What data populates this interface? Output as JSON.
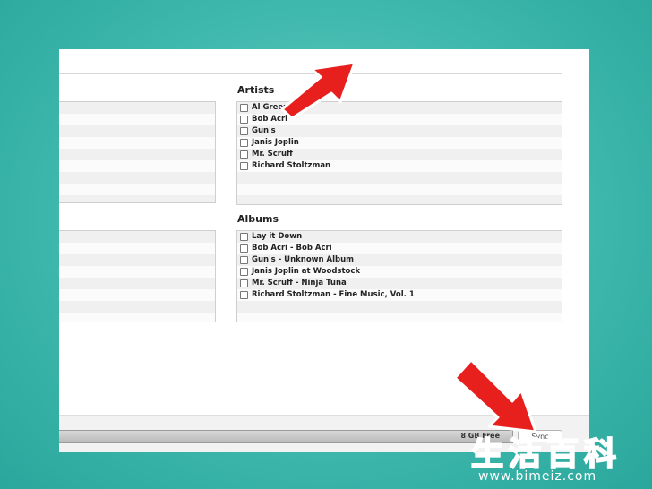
{
  "artists": {
    "title": "Artists",
    "items": [
      "Al Green",
      "Bob Acri",
      "Gun's",
      "Janis Joplin",
      "Mr. Scruff",
      "Richard Stoltzman"
    ]
  },
  "albums": {
    "title": "Albums",
    "items": [
      "Lay it Down",
      "Bob Acri - Bob Acri",
      "Gun's - Unknown Album",
      "Janis Joplin at Woodstock",
      "Mr. Scruff - Ninja Tuna",
      "Richard Stoltzman - Fine Music, Vol. 1"
    ]
  },
  "footer": {
    "capacity_label": "8 GB Free",
    "sync_label": "Sync"
  },
  "watermark": {
    "chars": [
      "生",
      "活",
      "百",
      "科"
    ],
    "url": "www.bimeiz.com"
  },
  "colors": {
    "background": "#3fb8ad",
    "arrow": "#e8201d"
  },
  "icons": [
    "checkbox-icon",
    "red-arrow-icon"
  ]
}
